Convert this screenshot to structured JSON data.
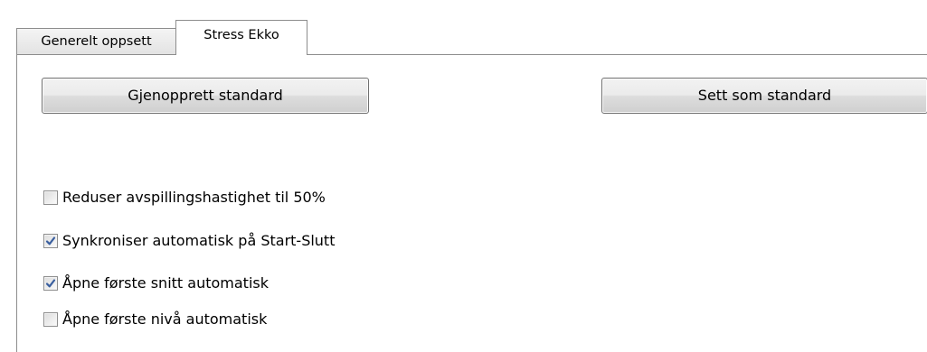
{
  "tabs": [
    {
      "label": "Generelt oppsett",
      "active": false
    },
    {
      "label": "Stress Ekko",
      "active": true
    }
  ],
  "buttons": {
    "restore_defaults": "Gjenopprett standard",
    "set_as_default": "Sett som standard"
  },
  "options": [
    {
      "label": "Reduser avspillingshastighet til 50%",
      "checked": false
    },
    {
      "label": "Synkroniser automatisk på Start-Slutt",
      "checked": true
    },
    {
      "label": "Åpne første snitt automatisk",
      "checked": true
    },
    {
      "label": "Åpne første nivå automatisk",
      "checked": false
    }
  ],
  "colors": {
    "checkmark": "#3a5f9f",
    "border": "#8d8d8d"
  },
  "icons": {
    "checkmark": "checkmark-icon"
  }
}
